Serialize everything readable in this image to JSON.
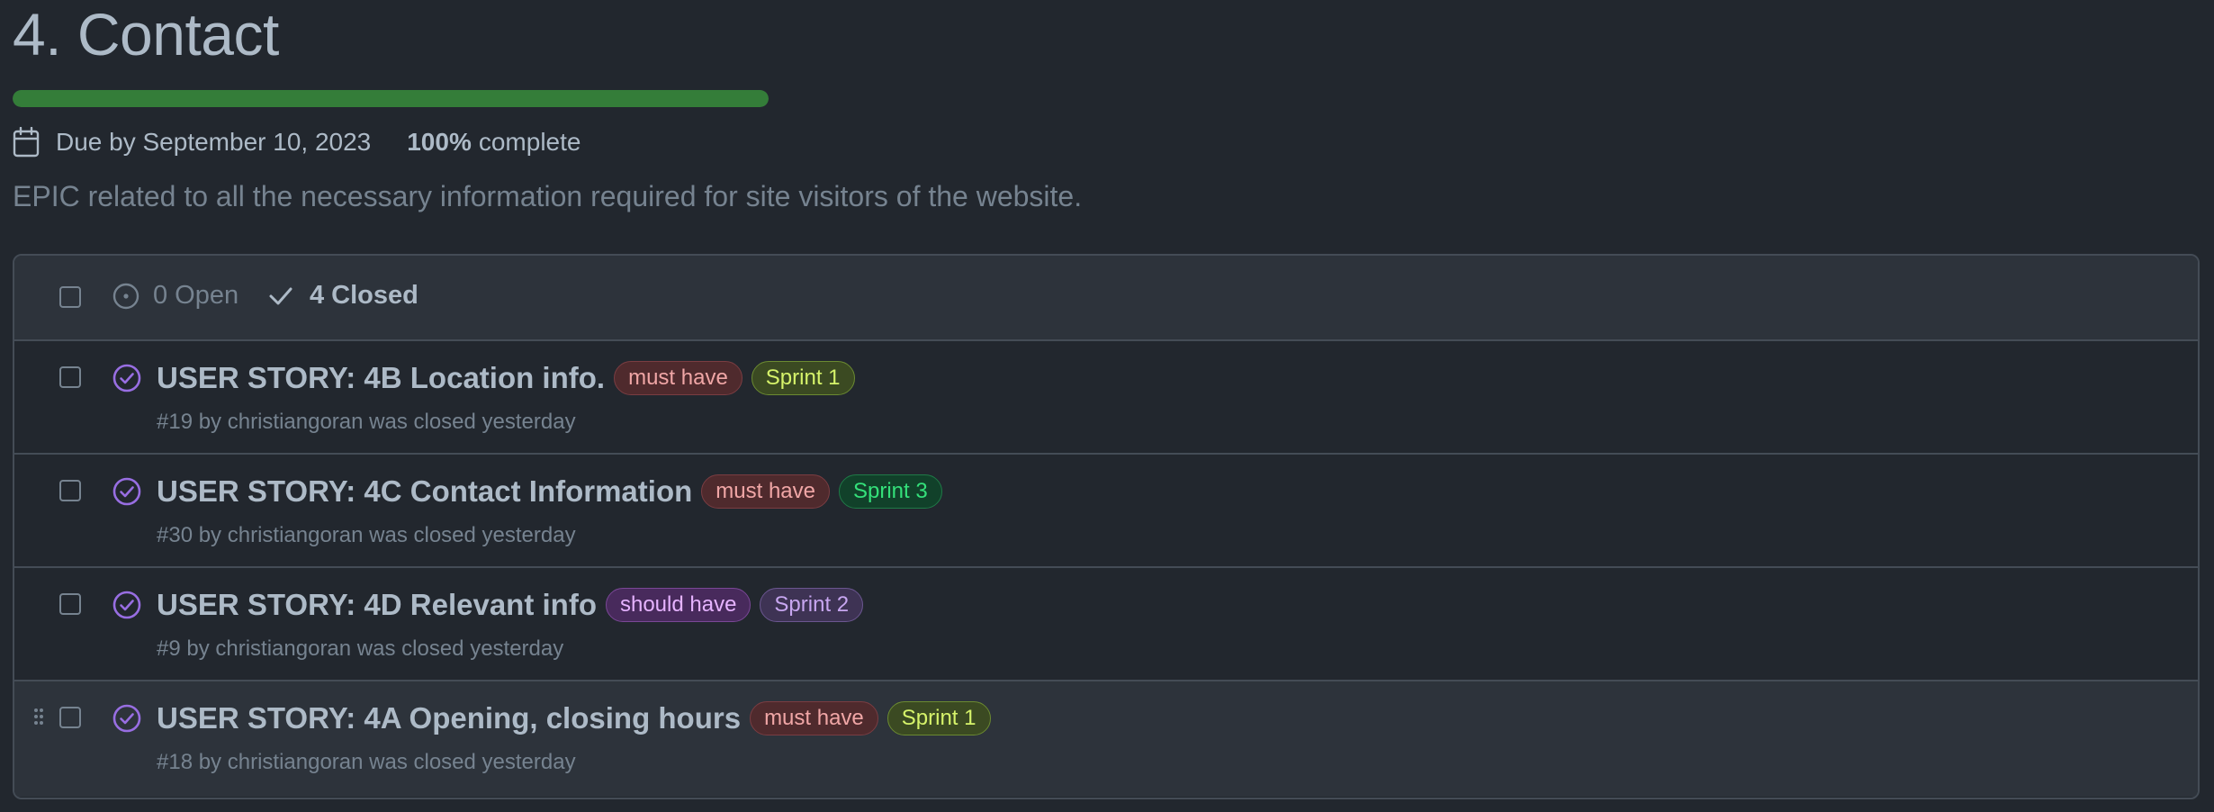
{
  "milestone": {
    "title": "4. Contact",
    "progress": 1.0,
    "due_text": "Due by September 10, 2023",
    "percent": "100%",
    "percent_label": "complete",
    "description": "EPIC related to all the necessary information required for site visitors of the website."
  },
  "list_header": {
    "open_label": "0 Open",
    "closed_label": "4 Closed"
  },
  "issues": [
    {
      "title": "USER STORY: 4B Location info.",
      "labels": [
        {
          "text": "must have",
          "kind": "must"
        },
        {
          "text": "Sprint 1",
          "kind": "s1"
        }
      ],
      "meta": "#19 by christiangoran was closed yesterday"
    },
    {
      "title": "USER STORY: 4C Contact Information",
      "labels": [
        {
          "text": "must have",
          "kind": "must"
        },
        {
          "text": "Sprint 3",
          "kind": "s3"
        }
      ],
      "meta": "#30 by christiangoran was closed yesterday"
    },
    {
      "title": "USER STORY: 4D Relevant info",
      "labels": [
        {
          "text": "should have",
          "kind": "should"
        },
        {
          "text": "Sprint 2",
          "kind": "s2"
        }
      ],
      "meta": "#9 by christiangoran was closed yesterday"
    },
    {
      "title": "USER STORY: 4A Opening, closing hours",
      "labels": [
        {
          "text": "must have",
          "kind": "must"
        },
        {
          "text": "Sprint 1",
          "kind": "s1"
        }
      ],
      "meta": "#18 by christiangoran was closed yesterday"
    }
  ],
  "colors": {
    "background": "#22272e",
    "progress": "#347d39",
    "closed_icon": "#986ee2"
  }
}
